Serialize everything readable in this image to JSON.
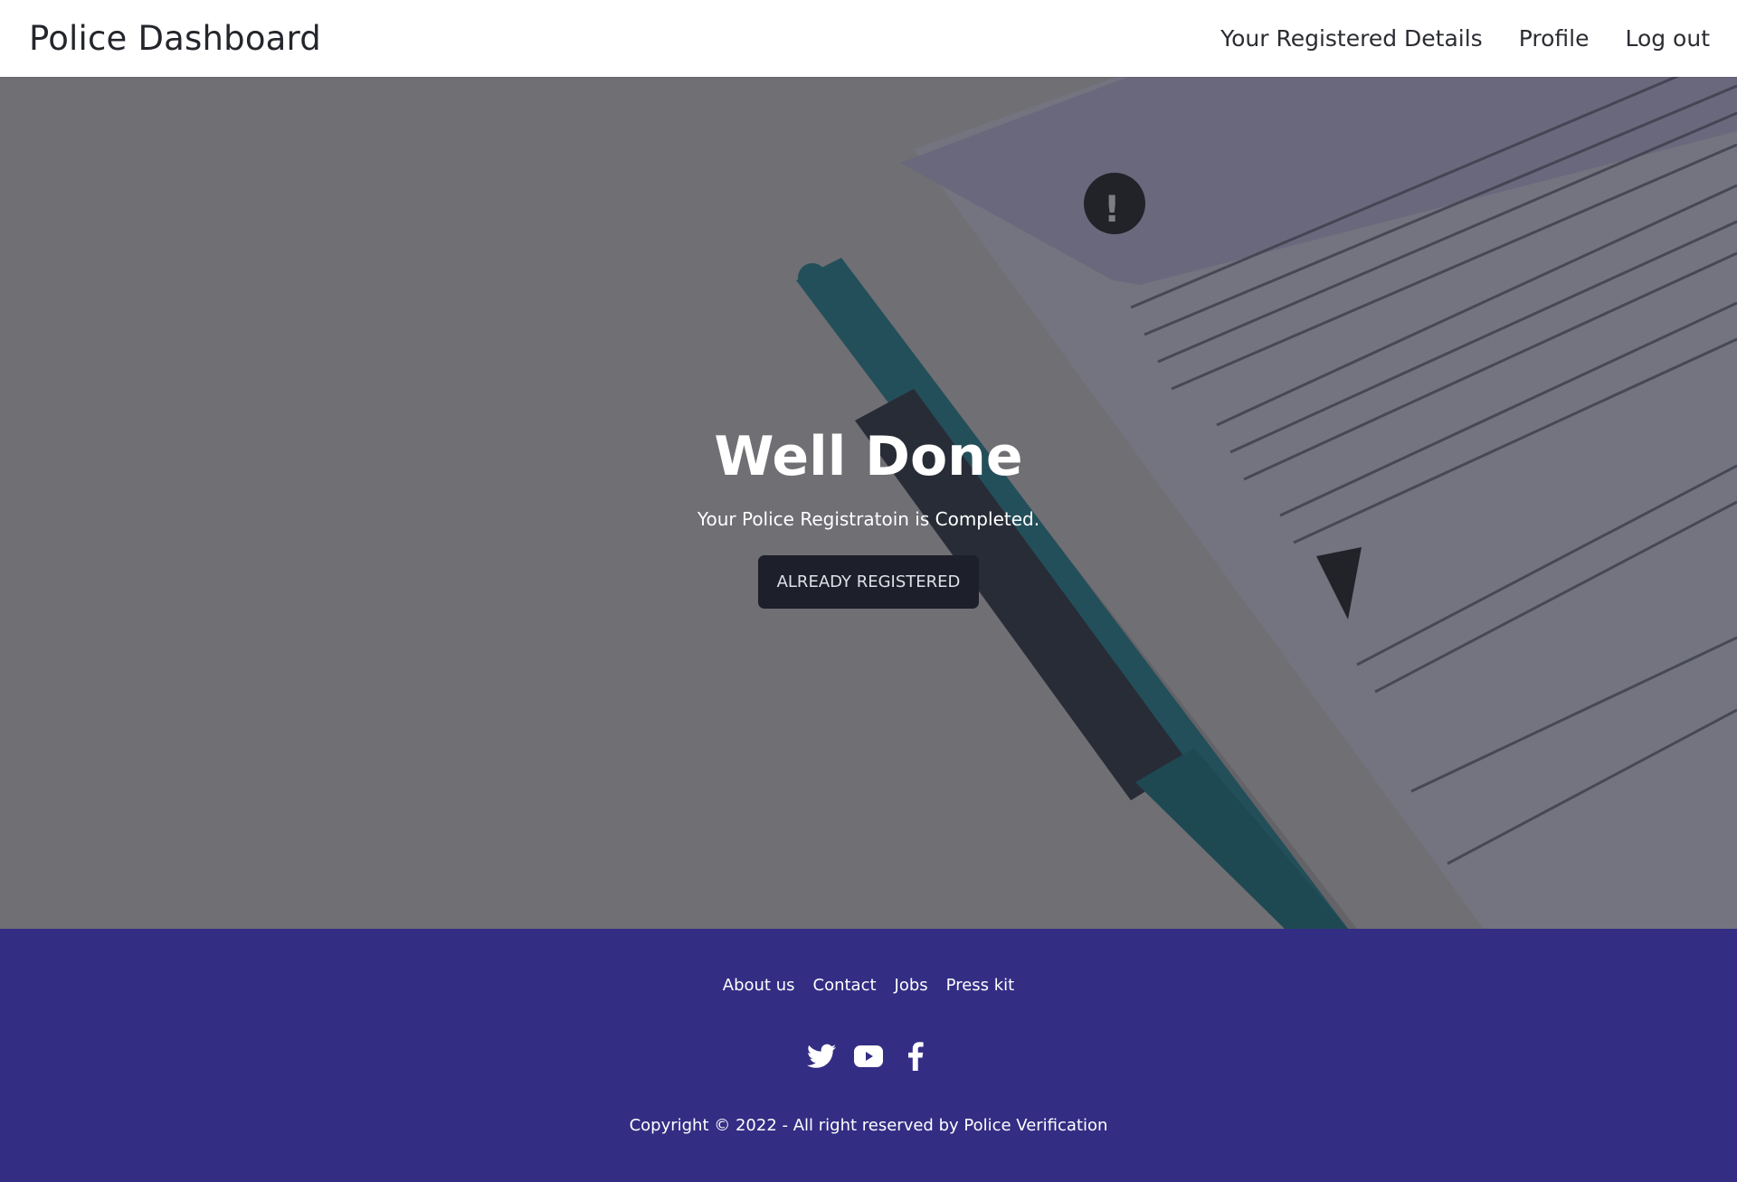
{
  "navbar": {
    "brand": "Police Dashboard",
    "links": [
      "Your Registered Details",
      "Profile",
      "Log out"
    ]
  },
  "hero": {
    "title": "Well Done",
    "subtitle": "Your Police Registratoin is Completed.",
    "button_label": "ALREADY REGISTERED"
  },
  "footer": {
    "links": [
      "About us",
      "Contact",
      "Jobs",
      "Press kit"
    ],
    "social_icons": [
      "twitter-icon",
      "youtube-icon",
      "facebook-icon"
    ],
    "copyright": "Copyright © 2022 - All right reserved by Police Verification"
  },
  "colors": {
    "footer_bg": "#332d84",
    "button_bg": "#1d1f2a",
    "navbar_bg": "#ffffff"
  }
}
